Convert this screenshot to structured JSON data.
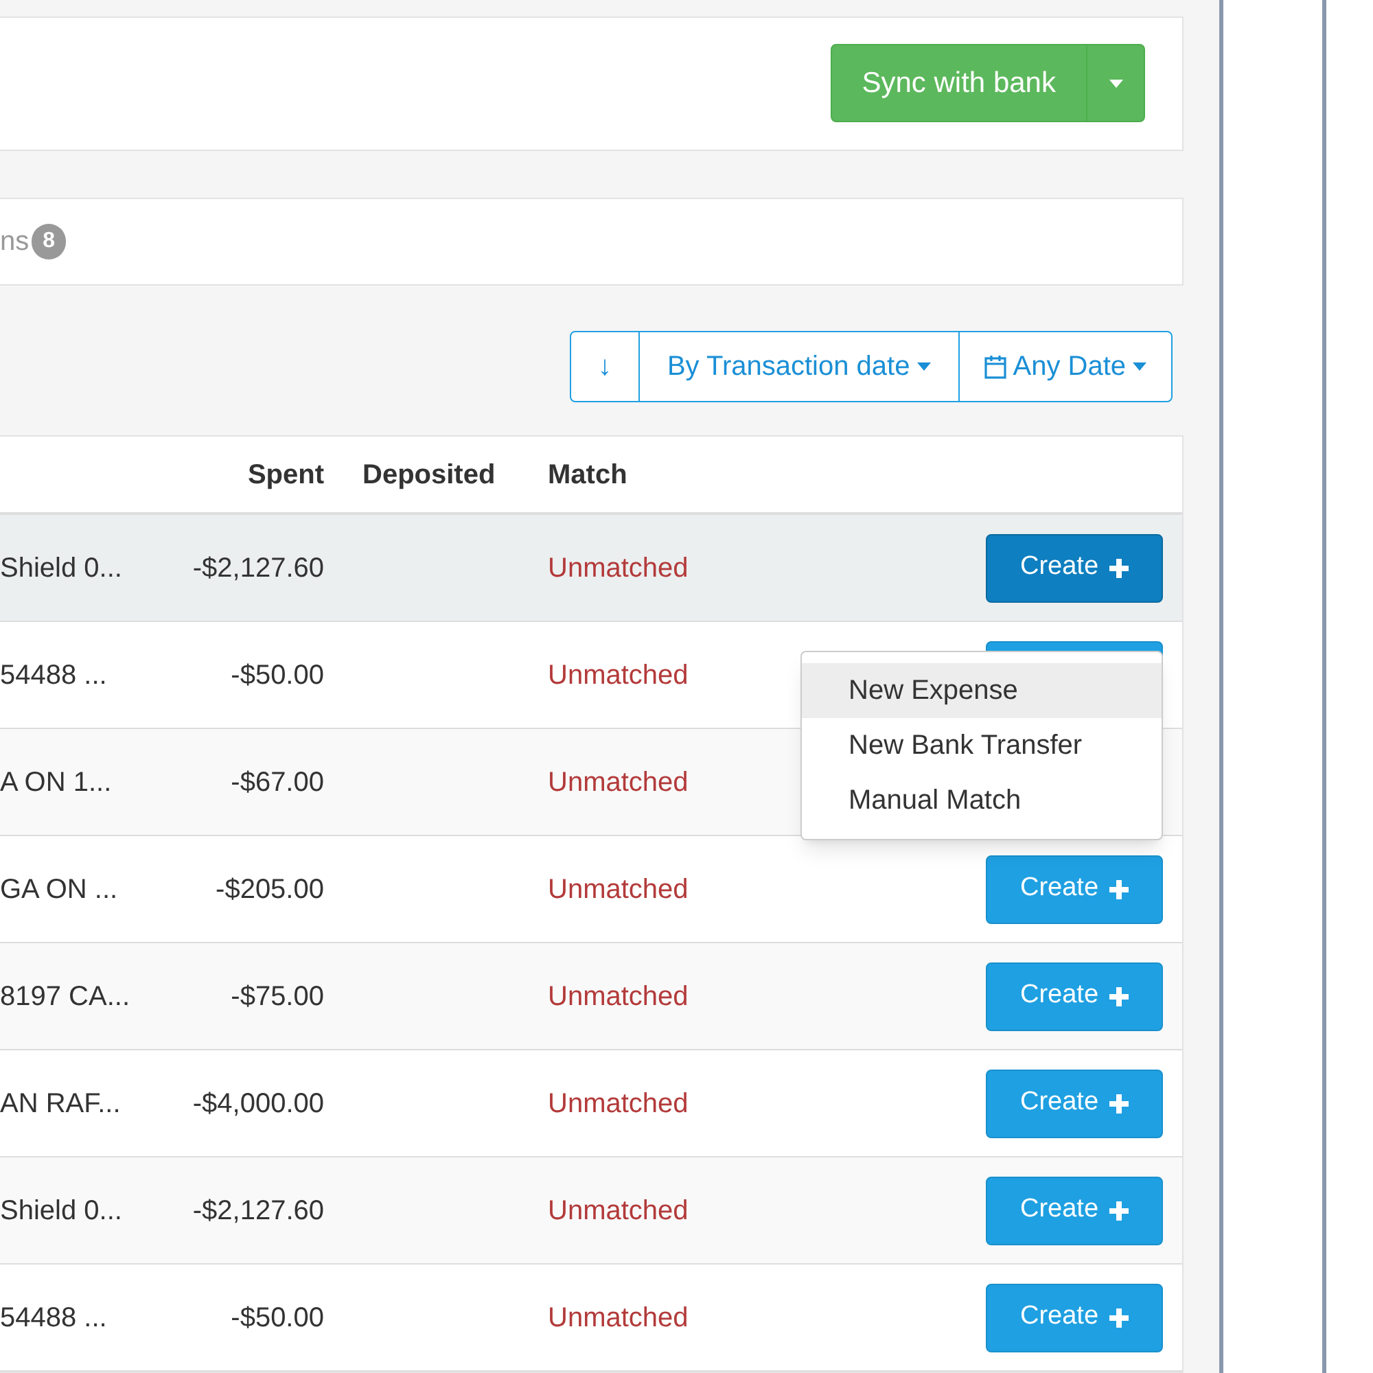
{
  "header": {
    "sync_button": "Sync with bank"
  },
  "tabs": [
    {
      "label": "ns",
      "count": "8",
      "selected": true
    }
  ],
  "toolbar": {
    "sort_direction": "↓",
    "sort_by": "By Transaction date",
    "date_filter": "Any Date"
  },
  "table": {
    "columns": [
      "Spent",
      "Deposited",
      "Match"
    ],
    "rows": [
      {
        "description": "Shield 0...",
        "spent": "-$2,127.60",
        "match": "Unmatched",
        "button": "Create",
        "active": true
      },
      {
        "description": "54488 ...",
        "spent": "-$50.00",
        "match": "Unmatched",
        "active": false
      },
      {
        "description": "A ON 1...",
        "spent": "-$67.00",
        "match": "Unmatched",
        "active": false
      },
      {
        "description": "GA ON ...",
        "spent": "-$205.00",
        "match": "Unmatched",
        "button": "Create",
        "active": false
      },
      {
        "description": "8197 CA...",
        "spent": "-$75.00",
        "match": "Unmatched",
        "button": "Create",
        "active": false
      },
      {
        "description": "AN RAF...",
        "spent": "-$4,000.00",
        "match": "Unmatched",
        "button": "Create",
        "active": false
      },
      {
        "description": "Shield 0...",
        "spent": "-$2,127.60",
        "match": "Unmatched",
        "button": "Create",
        "active": false
      },
      {
        "description": "54488 ...",
        "spent": "-$50.00",
        "match": "Unmatched",
        "button": "Create",
        "active": false
      }
    ]
  },
  "menu": {
    "open": true,
    "items": [
      {
        "label": "New Expense",
        "selected": true
      },
      {
        "label": "New Bank Transfer",
        "selected": false
      },
      {
        "label": "Manual Match",
        "selected": false
      }
    ]
  }
}
